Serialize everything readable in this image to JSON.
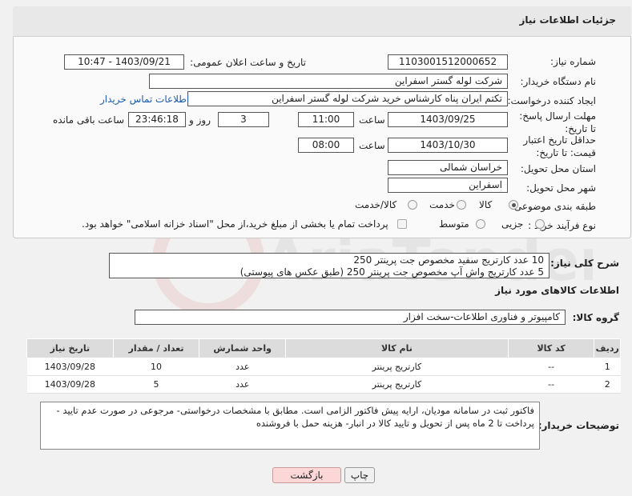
{
  "header": {
    "title": "جزئیات اطلاعات نیاز"
  },
  "fields": {
    "need_number_label": "شماره نیاز:",
    "need_number": "1103001512000652",
    "announce_label": "تاریخ و ساعت اعلان عمومی:",
    "announce_value": "1403/09/21 - 10:47",
    "buyer_org_label": "نام دستگاه خریدار:",
    "buyer_org": "شرکت لوله گستر اسفراین",
    "creator_label": "ایجاد کننده درخواست:",
    "creator": "تکتم ایران پناه کارشناس خرید شرکت لوله گستر اسفراین",
    "contact_link": "اطلاعات تماس خریدار",
    "deadline_label": "مهلت ارسال پاسخ: تا تاریخ:",
    "deadline_date": "1403/09/25",
    "time_label": "ساعت",
    "deadline_time": "11:00",
    "days_value": "3",
    "days_label": "روز و",
    "remaining_value": "23:46:18",
    "remaining_label": "ساعت باقی مانده",
    "validity_label": "حداقل تاریخ اعتبار قیمت: تا تاریخ:",
    "validity_date": "1403/10/30",
    "validity_time": "08:00",
    "province_label": "استان محل تحویل:",
    "province": "خراسان شمالی",
    "city_label": "شهر محل تحویل:",
    "city": "اسفراین",
    "category_label": "طبقه بندی موضوعی:",
    "category_options": [
      "کالا",
      "خدمت",
      "کالا/خدمت"
    ],
    "process_label": "نوع فرآیند خرید :",
    "process_options": [
      "جزیی",
      "متوسط"
    ],
    "payment_note": "پرداخت تمام یا بخشی از مبلغ خرید،از محل \"اسناد خزانه اسلامی\" خواهد بود."
  },
  "description": {
    "label": "شرح کلی نیاز:",
    "line1": "10 عدد کارتریج سفید مخصوص جت پرینتر 250",
    "line2": "5 عدد کارتریج واش آپ مخصوص جت پرینتر 250 (طبق عکس های پیوستی)"
  },
  "goods": {
    "section_title": "اطلاعات کالاهای مورد نیاز",
    "group_label": "گروه کالا:",
    "group_value": "کامپیوتر و فناوری اطلاعات-سخت افزار",
    "columns": [
      "ردیف",
      "کد کالا",
      "نام کالا",
      "واحد شمارش",
      "تعداد / مقدار",
      "تاریخ نیاز"
    ],
    "rows": [
      [
        "1",
        "--",
        "کارتریج پرینتر",
        "عدد",
        "10",
        "1403/09/28"
      ],
      [
        "2",
        "--",
        "کارتریج پرینتر",
        "عدد",
        "5",
        "1403/09/28"
      ]
    ]
  },
  "buyer_notes": {
    "label": "توضیحات خریدار:",
    "line1": "فاکتور ثبت در سامانه مودیان، ارایه پیش فاکتور الزامی است. مطابق با مشخصات درخواستی- مرجوعی در صورت عدم تایید -",
    "line2": "پرداخت تا 2 ماه پس از تحویل و تایید کالا در انبار- هزینه حمل با فروشنده"
  },
  "buttons": {
    "print": "چاپ",
    "back": "بازگشت"
  },
  "watermark_text": "AriaTender.neT"
}
